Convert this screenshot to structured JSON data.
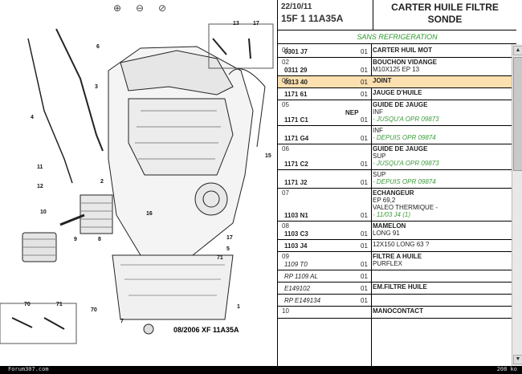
{
  "toolbar": {
    "zoom_in": "⊕",
    "zoom_out": "⊖",
    "zoom_reset": "⊘"
  },
  "diagram": {
    "caption": "08/2006  XF 11A35A",
    "callouts": [
      "13",
      "17",
      "6",
      "3",
      "4",
      "11",
      "15",
      "12",
      "2",
      "16",
      "10",
      "8",
      "17",
      "5",
      "9",
      "1",
      "71",
      "70",
      "71",
      "7",
      "70"
    ]
  },
  "header": {
    "date": "22/10/11",
    "code": "15F 1 11A35A",
    "title_line1": "CARTER HUILE FILTRE",
    "title_line2": "SONDE"
  },
  "sans_refrigeration": "SANS REFRIGERATION",
  "rows": [
    {
      "idx": "01",
      "ref": "0301 J7",
      "qty": "01",
      "desc": [
        "CARTER HUIL MOT"
      ],
      "bold_first": true
    },
    {
      "idx": "02",
      "ref": "0311 29",
      "qty": "01",
      "desc": [
        "BOUCHON VIDANGE",
        "M10X125 EP 13"
      ],
      "bold_first": true
    },
    {
      "idx": "05",
      "ref": "0313 40",
      "qty": "01",
      "desc": [
        "JOINT"
      ],
      "bold_first": true,
      "highlight": true
    },
    {
      "idx": "",
      "ref": "1171 61",
      "qty": "01",
      "desc": [
        "JAUGE D'HUILE"
      ],
      "bold_first": true
    },
    {
      "idx": "05",
      "ref": "1171 C1",
      "mid": "NEP",
      "qty": "01",
      "desc": [
        "GUIDE DE JAUGE",
        "INF",
        "- JUSQU'A OPR 09873"
      ],
      "bold_first": true
    },
    {
      "idx": "",
      "ref": "1171 G4",
      "qty": "01",
      "desc": [
        "INF",
        "- DEPUIS OPR 09874"
      ]
    },
    {
      "idx": "06",
      "ref": "1171 C2",
      "qty": "01",
      "desc": [
        "GUIDE DE JAUGE",
        "SUP",
        "- JUSQU'A OPR 09873"
      ],
      "bold_first": true
    },
    {
      "idx": "",
      "ref": "1171 J2",
      "qty": "01",
      "desc": [
        "SUP",
        "- DEPUIS OPR 09874"
      ]
    },
    {
      "idx": "07",
      "ref": "1103 N1",
      "qty": "01",
      "desc": [
        "ECHANGEUR",
        "EP 69,2",
        "VALEO THERMIQUE -",
        "- 11/03 J4 (1)"
      ],
      "bold_first": true
    },
    {
      "idx": "08",
      "ref": "1103 C3",
      "qty": "01",
      "desc": [
        "MAMELON",
        "LONG 91"
      ],
      "bold_first": true
    },
    {
      "idx": "",
      "ref": "1103 J4",
      "qty": "01",
      "desc": [
        "12X150 LONG 63 ?"
      ]
    },
    {
      "idx": "09",
      "ref": "1109 T0",
      "qty": "01",
      "desc": [
        "FILTRE A HUILE",
        "PURFLEX"
      ],
      "bold_first": true,
      "ital_ref": true
    },
    {
      "idx": "",
      "ref": "RP 1109 AL",
      "qty": "01",
      "desc": [],
      "ital_ref": true
    },
    {
      "idx": "",
      "ref": "E149102",
      "qty": "01",
      "desc": [
        "EM.FILTRE HUILE"
      ],
      "bold_first": true,
      "ital_ref": true
    },
    {
      "idx": "",
      "ref": "RP E149134",
      "qty": "01",
      "desc": [],
      "ital_ref": true
    },
    {
      "idx": "10",
      "ref": "",
      "qty": "",
      "desc": [
        "MANOCONTACT"
      ],
      "bold_first": true
    }
  ],
  "footer": {
    "left": "Forum307.com",
    "right": "208 ko"
  }
}
